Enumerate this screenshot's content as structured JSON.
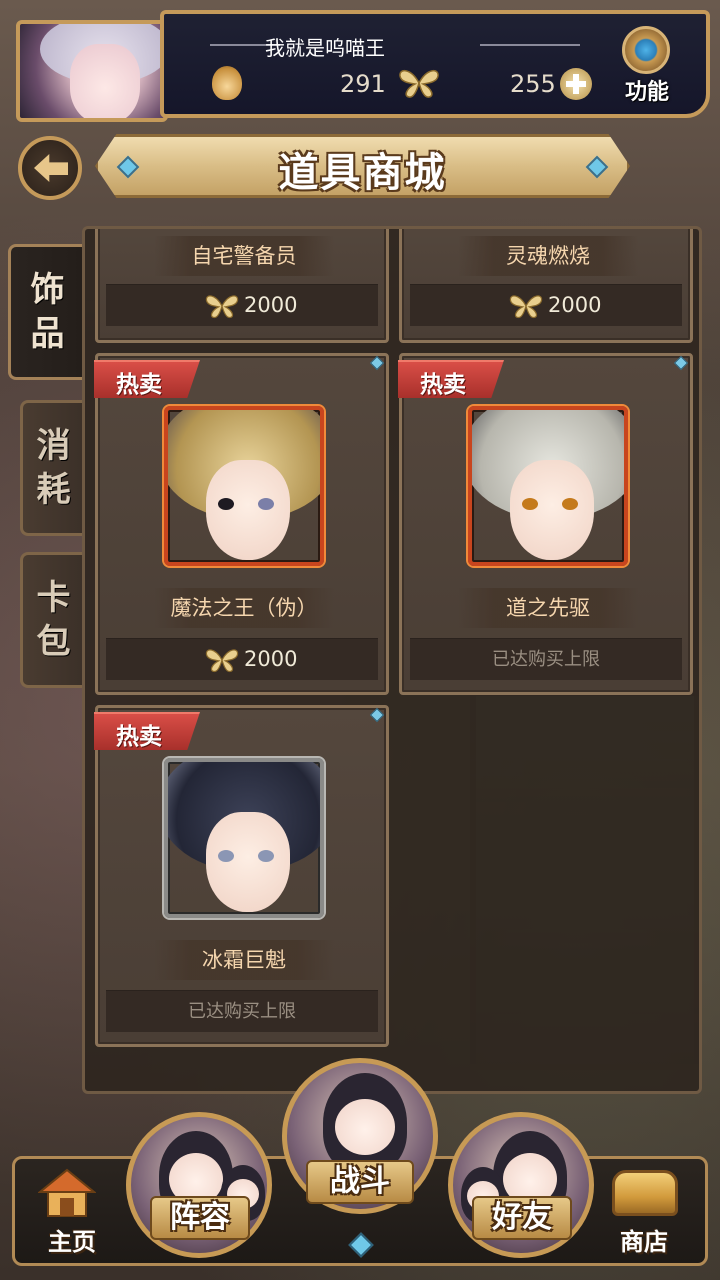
{
  "header": {
    "player_name": "我就是呜喵王",
    "currency_a": "291",
    "currency_b": "255",
    "function_label": "功能"
  },
  "title_bar": {
    "title": "道具商城"
  },
  "side_tabs": [
    {
      "chars": [
        "饰",
        "品"
      ],
      "active": true
    },
    {
      "chars": [
        "消",
        "耗"
      ],
      "active": false
    },
    {
      "chars": [
        "卡",
        "包"
      ],
      "active": false
    }
  ],
  "shop": {
    "hot_label": "热卖",
    "limit_label": "已达购买上限",
    "items": [
      {
        "name": "自宅警备员",
        "price": "2000"
      },
      {
        "name": "灵魂燃烧",
        "price": "2000"
      },
      {
        "name": "魔法之王（伪）",
        "price": "2000"
      },
      {
        "name": "道之先驱"
      },
      {
        "name": "冰霜巨魁"
      }
    ]
  },
  "bottom_nav": {
    "home": "主页",
    "lineup": "阵容",
    "battle": "战斗",
    "friends": "好友",
    "store": "商店"
  },
  "colors": {
    "accent_gold": "#c59a5a",
    "hot_red": "#d94e47",
    "name_text": "#f5d6ae"
  }
}
